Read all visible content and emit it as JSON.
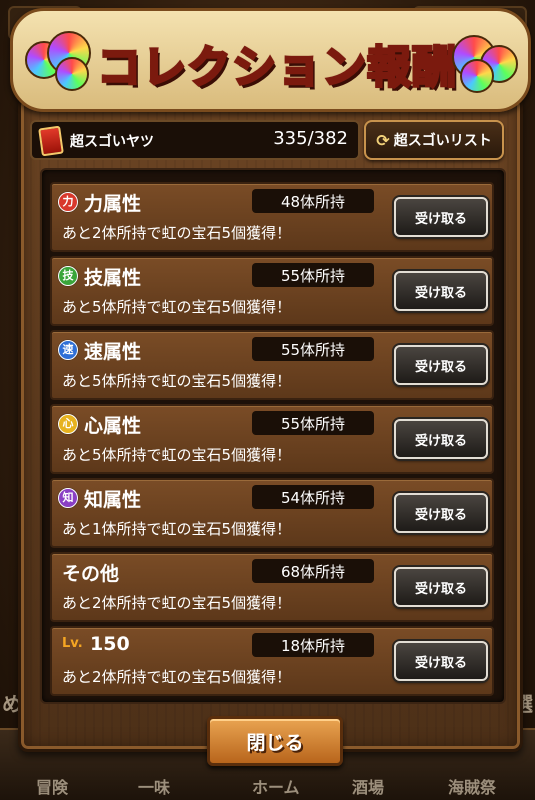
{
  "dialog": {
    "title": "コレクション報酬",
    "header_label": "超スゴいヤツ",
    "header_count": "335/382",
    "list_button_label": "超スゴいリスト",
    "close_label": "閉じる"
  },
  "rows": [
    {
      "icon": "力",
      "icon_color": "#d8382c",
      "title": "力属性",
      "count": "48体所持",
      "desc": "あと2体所持で虹の宝石5個獲得！",
      "button": "受け取る"
    },
    {
      "icon": "技",
      "icon_color": "#3aa53a",
      "title": "技属性",
      "count": "55体所持",
      "desc": "あと5体所持で虹の宝石5個獲得！",
      "button": "受け取る"
    },
    {
      "icon": "速",
      "icon_color": "#2f6fd6",
      "title": "速属性",
      "count": "55体所持",
      "desc": "あと5体所持で虹の宝石5個獲得！",
      "button": "受け取る"
    },
    {
      "icon": "心",
      "icon_color": "#e6b21f",
      "title": "心属性",
      "count": "55体所持",
      "desc": "あと5体所持で虹の宝石5個獲得！",
      "button": "受け取る"
    },
    {
      "icon": "知",
      "icon_color": "#8a3fc4",
      "title": "知属性",
      "count": "54体所持",
      "desc": "あと1体所持で虹の宝石5個獲得！",
      "button": "受け取る"
    },
    {
      "title": "その他",
      "count": "68体所持",
      "desc": "あと2体所持で虹の宝石5個獲得！",
      "button": "受け取る"
    },
    {
      "lv_label": "Lv.",
      "title": "150",
      "count": "18体所持",
      "desc": "あと2体所持で虹の宝石5個獲得！",
      "button": "受け取る"
    }
  ],
  "background": {
    "side_left": "めて",
    "side_right": "選",
    "nav": [
      "冒険",
      "一味",
      "ホーム",
      "酒場",
      "海賊祭"
    ]
  }
}
